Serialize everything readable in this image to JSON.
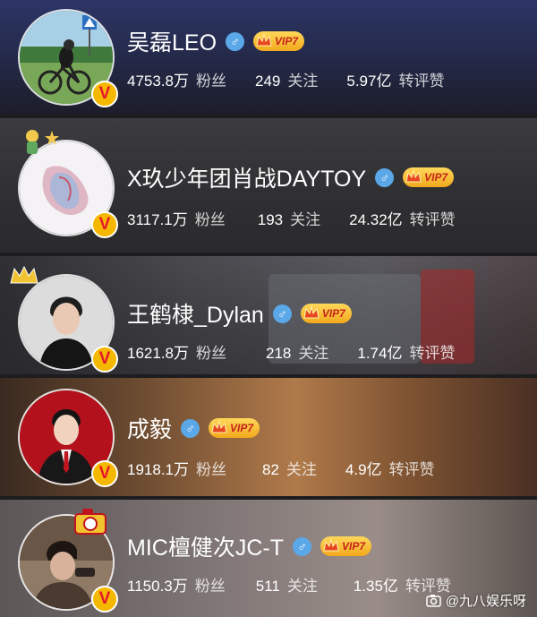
{
  "colors": {
    "male_badge": "#5aa8e8",
    "vip_gold": "#f2a81c",
    "vip_text": "#c4221a",
    "verified_badge": "#f5b800",
    "verified_v": "#e6162d"
  },
  "profiles": [
    {
      "name": "吴磊LEO",
      "gender_icon": "male-icon",
      "vip": "VIP7",
      "verified": "V",
      "followers": "4753.8万",
      "followers_label": "粉丝",
      "following": "249",
      "following_label": "关注",
      "interactions": "5.97亿",
      "interactions_label": "转评赞"
    },
    {
      "name": "X玖少年团肖战DAYTOY",
      "gender_icon": "male-icon",
      "vip": "VIP7",
      "verified": "V",
      "followers": "3117.1万",
      "followers_label": "粉丝",
      "following": "193",
      "following_label": "关注",
      "interactions": "24.32亿",
      "interactions_label": "转评赞"
    },
    {
      "name": "王鹤棣_Dylan",
      "gender_icon": "male-icon",
      "vip": "VIP7",
      "verified": "V",
      "followers": "1621.8万",
      "followers_label": "粉丝",
      "following": "218",
      "following_label": "关注",
      "interactions": "1.74亿",
      "interactions_label": "转评赞"
    },
    {
      "name": "成毅",
      "gender_icon": "male-icon",
      "vip": "VIP7",
      "verified": "V",
      "followers": "1918.1万",
      "followers_label": "粉丝",
      "following": "82",
      "following_label": "关注",
      "interactions": "4.9亿",
      "interactions_label": "转评赞"
    },
    {
      "name": "MIC檀健次JC-T",
      "gender_icon": "male-icon",
      "vip": "VIP7",
      "verified": "V",
      "followers": "1150.3万",
      "followers_label": "粉丝",
      "following": "511",
      "following_label": "关注",
      "interactions": "1.35亿",
      "interactions_label": "转评赞"
    }
  ],
  "watermark": {
    "text": "@九八娱乐呀",
    "icon": "camera-icon"
  }
}
